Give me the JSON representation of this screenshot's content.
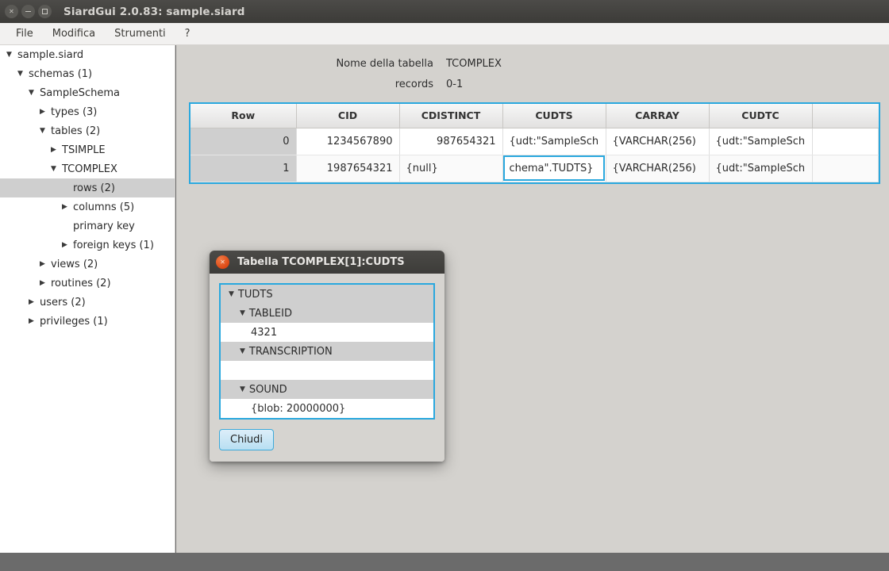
{
  "window": {
    "title": "SiardGui 2.0.83: sample.siard",
    "controls": [
      {
        "name": "close",
        "glyph": "✕"
      },
      {
        "name": "minimize",
        "glyph": ""
      },
      {
        "name": "maximize",
        "glyph": ""
      }
    ]
  },
  "menubar": {
    "items": [
      {
        "label": "File"
      },
      {
        "label": "Modifica"
      },
      {
        "label": "Strumenti"
      },
      {
        "label": "?"
      }
    ]
  },
  "sidebar": {
    "items": [
      {
        "label": "sample.siard",
        "indent": 0,
        "twisty": "▼",
        "selected": false
      },
      {
        "label": "schemas (1)",
        "indent": 1,
        "twisty": "▼",
        "selected": false
      },
      {
        "label": "SampleSchema",
        "indent": 2,
        "twisty": "▼",
        "selected": false
      },
      {
        "label": "types (3)",
        "indent": 3,
        "twisty": "▶",
        "selected": false
      },
      {
        "label": "tables (2)",
        "indent": 3,
        "twisty": "▼",
        "selected": false
      },
      {
        "label": "TSIMPLE",
        "indent": 4,
        "twisty": "▶",
        "selected": false
      },
      {
        "label": "TCOMPLEX",
        "indent": 4,
        "twisty": "▼",
        "selected": false
      },
      {
        "label": "rows (2)",
        "indent": 5,
        "twisty": "",
        "selected": true
      },
      {
        "label": "columns (5)",
        "indent": 5,
        "twisty": "▶",
        "selected": false
      },
      {
        "label": "primary key",
        "indent": 5,
        "twisty": "",
        "selected": false
      },
      {
        "label": "foreign keys (1)",
        "indent": 5,
        "twisty": "▶",
        "selected": false
      },
      {
        "label": "views (2)",
        "indent": 3,
        "twisty": "▶",
        "selected": false
      },
      {
        "label": "routines (2)",
        "indent": 3,
        "twisty": "▶",
        "selected": false
      },
      {
        "label": "users (2)",
        "indent": 2,
        "twisty": "▶",
        "selected": false
      },
      {
        "label": "privileges (1)",
        "indent": 2,
        "twisty": "▶",
        "selected": false
      }
    ]
  },
  "main": {
    "table_name_label": "Nome della tabella",
    "table_name_value": "TCOMPLEX",
    "records_label": "records",
    "records_value": "0-1",
    "table": {
      "headers": [
        "Row",
        "CID",
        "CDISTINCT",
        "CUDTS",
        "CARRAY",
        "CUDTC",
        ""
      ],
      "rows": [
        {
          "row": "0",
          "cells": [
            "1234567890",
            "987654321",
            "{udt:\"SampleSch",
            "{VARCHAR(256)",
            "{udt:\"SampleSch",
            ""
          ]
        },
        {
          "row": "1",
          "cells": [
            "1987654321",
            "{null}",
            "chema\".TUDTS}",
            "{VARCHAR(256)",
            "{udt:\"SampleSch",
            ""
          ]
        }
      ],
      "selected_cell": {
        "row": 1,
        "column": "CUDTS"
      }
    }
  },
  "dialog": {
    "title": "Tabella TCOMPLEX[1]:CUDTS",
    "close_glyph": "✕",
    "tree": [
      {
        "label": "TUDTS",
        "indent": 0,
        "twisty": "▼",
        "type": "node"
      },
      {
        "label": "TABLEID",
        "indent": 1,
        "twisty": "▼",
        "type": "node"
      },
      {
        "label": "4321",
        "indent": 2,
        "twisty": "",
        "type": "leaf"
      },
      {
        "label": "TRANSCRIPTION",
        "indent": 1,
        "twisty": "▼",
        "type": "node"
      },
      {
        "label": "",
        "indent": 2,
        "twisty": "",
        "type": "leaf"
      },
      {
        "label": "SOUND",
        "indent": 1,
        "twisty": "▼",
        "type": "node"
      },
      {
        "label": "{blob: 20000000}",
        "indent": 2,
        "twisty": "",
        "type": "leaf"
      }
    ],
    "close_button_label": "Chiudi"
  },
  "colors": {
    "accent_blue": "#2aa8de",
    "titlebar_dark": "#3d3c39",
    "dialog_close_orange": "#dd4814",
    "selection_gray": "#cfcfcf",
    "panel_gray": "#d4d2ce"
  }
}
